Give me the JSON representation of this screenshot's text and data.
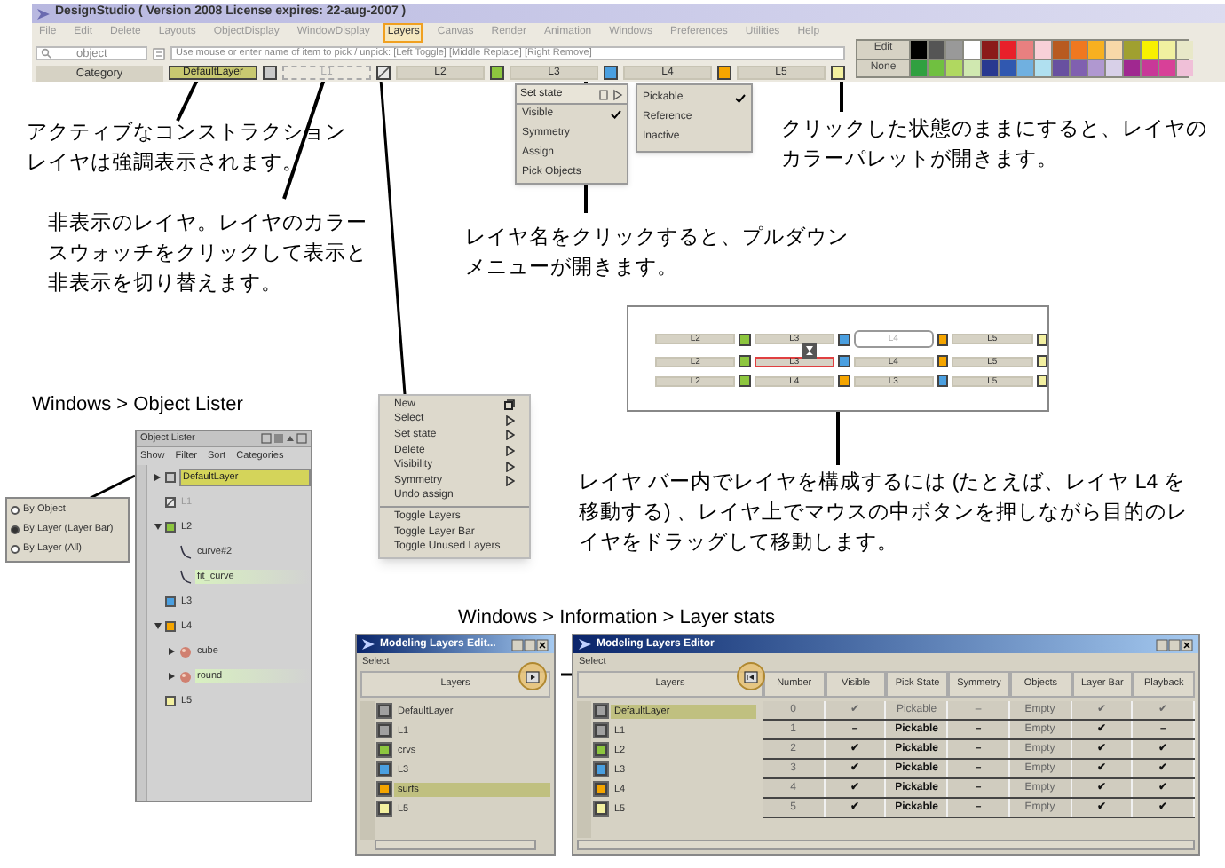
{
  "app_window": {
    "title": "DesignStudio ( Version 2008  License expires: 22-aug-2007 )",
    "menu": [
      {
        "label": "File",
        "selected": false
      },
      {
        "label": "Edit",
        "selected": false
      },
      {
        "label": "Delete",
        "selected": false
      },
      {
        "label": "Layouts",
        "selected": false
      },
      {
        "label": "ObjectDisplay",
        "selected": false
      },
      {
        "label": "WindowDisplay",
        "selected": false
      },
      {
        "label": "Layers",
        "selected": true
      },
      {
        "label": "Canvas",
        "selected": false
      },
      {
        "label": "Render",
        "selected": false
      },
      {
        "label": "Animation",
        "selected": false
      },
      {
        "label": "Windows",
        "selected": false
      },
      {
        "label": "Preferences",
        "selected": false
      },
      {
        "label": "Utilities",
        "selected": false
      },
      {
        "label": "Help",
        "selected": false
      }
    ],
    "pick_field": {
      "value": "object"
    },
    "pick_hint": {
      "placeholder": "Use mouse or enter name of item to pick / unpick: [Left Toggle] [Middle Replace] [Right Remove]"
    },
    "layer_bar": {
      "category": "Category",
      "layers": [
        {
          "name": "DefaultLayer",
          "color": "#c8c8c8",
          "active": true,
          "visible": true
        },
        {
          "name": "L1",
          "color": "#e8e8e8",
          "active": false,
          "visible": false
        },
        {
          "name": "L2",
          "color": "#8dc63f",
          "active": false,
          "visible": true
        },
        {
          "name": "L3",
          "color": "#4a9fe0",
          "active": false,
          "visible": true
        },
        {
          "name": "L4",
          "color": "#f5a500",
          "active": false,
          "visible": true
        },
        {
          "name": "L5",
          "color": "#f3f0a0",
          "active": false,
          "visible": true
        }
      ]
    }
  },
  "palette": {
    "buttons": [
      "Edit",
      "None"
    ],
    "swatches": [
      {
        "color": "#000000"
      },
      {
        "color": "#555555"
      },
      {
        "color": "#999999"
      },
      {
        "color": "#ffffff"
      },
      {
        "color": "#8b1a1a"
      },
      {
        "color": "#e8202a"
      },
      {
        "color": "#e88080"
      },
      {
        "color": "#f8d0d8"
      },
      {
        "color": "#b85a20"
      },
      {
        "color": "#f07820"
      },
      {
        "color": "#f8b020"
      },
      {
        "color": "#f8d8a8"
      },
      {
        "color": "#a0a030"
      },
      {
        "color": "#f8f000"
      },
      {
        "color": "#f0f0a0"
      },
      {
        "color": "#e8e8c8"
      },
      {
        "color": "#30a040"
      },
      {
        "color": "#70c040"
      },
      {
        "color": "#b0d860"
      },
      {
        "color": "#d0e8b0"
      },
      {
        "color": "#283890"
      },
      {
        "color": "#3058b0"
      },
      {
        "color": "#70b0e0"
      },
      {
        "color": "#b0e0f0"
      },
      {
        "color": "#6850a0"
      },
      {
        "color": "#8060b0"
      },
      {
        "color": "#b098d0"
      },
      {
        "color": "#d8d0e8"
      },
      {
        "color": "#a02890"
      },
      {
        "color": "#c83898"
      },
      {
        "color": "#d84098"
      },
      {
        "color": "#f0c0d8"
      }
    ]
  },
  "layer_menu": {
    "title": "Set state",
    "items": [
      {
        "label": "Visible",
        "checked": true
      },
      {
        "label": "Symmetry",
        "checked": false
      },
      {
        "label": "Assign",
        "checked": false
      },
      {
        "label": "Pick Objects",
        "checked": false
      }
    ],
    "submenu": [
      {
        "label": "Pickable",
        "checked": true
      },
      {
        "label": "Reference",
        "checked": false
      },
      {
        "label": "Inactive",
        "checked": false
      }
    ]
  },
  "callouts": [
    {
      "text": "アクティブなコンストラクションレイヤは強調表示されます。"
    },
    {
      "text": "非表示のレイヤ。レイヤのカラースウォッチをクリックして表示と非表示を切り替えます。"
    },
    {
      "text": "クリックした状態のままにすると、レイヤのカラーパレットが開きます。"
    },
    {
      "text": "レイヤ名をクリックすると、プルダウンメニューが開きます。"
    },
    {
      "text": "レイヤ バー内でレイヤを構成するには (たとえば、レイヤ L4 を移動する) 、レイヤ上でマウスの中ボタンを押しながら目的のレイヤをドラッグして移動します。"
    }
  ],
  "layers_menu": {
    "groups": [
      [
        {
          "label": "New",
          "kind": "window"
        },
        {
          "label": "Select",
          "kind": "submenu"
        },
        {
          "label": "Set state",
          "kind": "submenu"
        },
        {
          "label": "Delete",
          "kind": "submenu"
        },
        {
          "label": "Visibility",
          "kind": "submenu"
        },
        {
          "label": "Symmetry",
          "kind": "submenu"
        },
        {
          "label": "Undo assign",
          "kind": "plain"
        }
      ],
      [
        {
          "label": "Toggle Layers",
          "kind": "plain"
        },
        {
          "label": "Toggle Layer Bar",
          "kind": "plain"
        },
        {
          "label": "Toggle Unused Layers",
          "kind": "plain"
        }
      ]
    ]
  },
  "reorder_demo": {
    "rows": [
      [
        {
          "name": "L2",
          "color": "#8dc63f",
          "kind": "normal"
        },
        {
          "name": "L3",
          "color": "#4a9fe0",
          "kind": "normal"
        },
        {
          "name": "L4",
          "color": "#f5a500",
          "kind": "ghost"
        },
        {
          "name": "L5",
          "color": "#f3f0a0",
          "kind": "normal"
        }
      ],
      [
        {
          "name": "L2",
          "color": "#8dc63f",
          "kind": "normal"
        },
        {
          "name": "L3",
          "color": "#4a9fe0",
          "kind": "drop"
        },
        {
          "name": "L4",
          "color": "#f5a500",
          "kind": "normal"
        },
        {
          "name": "L5",
          "color": "#f3f0a0",
          "kind": "normal"
        }
      ],
      [
        {
          "name": "L2",
          "color": "#8dc63f",
          "kind": "normal"
        },
        {
          "name": "L4",
          "color": "#f5a500",
          "kind": "normal"
        },
        {
          "name": "L3",
          "color": "#4a9fe0",
          "kind": "normal"
        },
        {
          "name": "L5",
          "color": "#f3f0a0",
          "kind": "normal"
        }
      ]
    ]
  },
  "object_lister": {
    "caption": "Windows > Object Lister",
    "title": "Object Lister",
    "menu": [
      "Show",
      "Filter",
      "Sort",
      "Categories"
    ],
    "show_options": [
      {
        "label": "By Object",
        "selected": false
      },
      {
        "label": "By Layer (Layer Bar)",
        "selected": true
      },
      {
        "label": "By Layer (All)",
        "selected": false
      }
    ],
    "tree": [
      {
        "label": "DefaultLayer",
        "kind": "layer",
        "color": "#c8c8c8",
        "hidden": false,
        "expanded": false,
        "active": true,
        "selected": false
      },
      {
        "label": "L1",
        "kind": "layer",
        "color": "#e8e8e8",
        "hidden": true,
        "active": false,
        "selected": false
      },
      {
        "label": "L2",
        "kind": "layer",
        "color": "#8dc63f",
        "hidden": false,
        "expanded": true,
        "active": false,
        "selected": false,
        "children": [
          {
            "label": "curve#2",
            "kind": "curve",
            "active": false,
            "selected": false
          },
          {
            "label": "fit_curve",
            "kind": "curve",
            "active": false,
            "selected": true
          }
        ]
      },
      {
        "label": "L3",
        "kind": "layer",
        "color": "#4a9fe0",
        "hidden": false,
        "active": false,
        "selected": false
      },
      {
        "label": "L4",
        "kind": "layer",
        "color": "#f5a500",
        "hidden": false,
        "expanded": true,
        "active": false,
        "selected": false,
        "children": [
          {
            "label": "cube",
            "kind": "object",
            "expanded": false,
            "active": false,
            "selected": false
          },
          {
            "label": "round",
            "kind": "object",
            "expanded": false,
            "active": false,
            "selected": true
          }
        ]
      },
      {
        "label": "L5",
        "kind": "layer",
        "color": "#f3f0a0",
        "hidden": false,
        "active": false,
        "selected": false
      }
    ]
  },
  "layer_stats": {
    "caption": "Windows > Information > Layer stats",
    "compact_editor": {
      "title": "Modeling Layers Edit...",
      "menu": "Select",
      "column": "Layers",
      "rows": [
        {
          "name": "DefaultLayer",
          "color": "#a0a0a0",
          "selected": false
        },
        {
          "name": "L1",
          "color": "#a0a0a0",
          "selected": false
        },
        {
          "name": "crvs",
          "color": "#8dc63f",
          "selected": false
        },
        {
          "name": "L3",
          "color": "#4a9fe0",
          "selected": false
        },
        {
          "name": "surfs",
          "color": "#f5a500",
          "selected": true
        },
        {
          "name": "L5",
          "color": "#f3f0a0",
          "selected": false
        }
      ]
    },
    "full_editor": {
      "title": "Modeling Layers Editor",
      "menu": "Select",
      "layers_column": "Layers",
      "columns": [
        "Number",
        "Visible",
        "Pick State",
        "Symmetry",
        "Objects",
        "Layer Bar",
        "Playback"
      ],
      "rows": [
        {
          "name": "DefaultLayer",
          "color": "#a0a0a0",
          "selected": true,
          "dimmed": true,
          "cells": [
            "0",
            "✔",
            "Pickable",
            "–",
            "Empty",
            "✔",
            "✔"
          ]
        },
        {
          "name": "L1",
          "color": "#a0a0a0",
          "selected": false,
          "dimmed": false,
          "cells": [
            "1",
            "–",
            "Pickable",
            "–",
            "Empty",
            "✔",
            "–"
          ]
        },
        {
          "name": "L2",
          "color": "#8dc63f",
          "selected": false,
          "dimmed": false,
          "cells": [
            "2",
            "✔",
            "Pickable",
            "–",
            "Empty",
            "✔",
            "✔"
          ]
        },
        {
          "name": "L3",
          "color": "#4a9fe0",
          "selected": false,
          "dimmed": false,
          "cells": [
            "3",
            "✔",
            "Pickable",
            "–",
            "Empty",
            "✔",
            "✔"
          ]
        },
        {
          "name": "L4",
          "color": "#f5a500",
          "selected": false,
          "dimmed": false,
          "cells": [
            "4",
            "✔",
            "Pickable",
            "–",
            "Empty",
            "✔",
            "✔"
          ]
        },
        {
          "name": "L5",
          "color": "#f3f0a0",
          "selected": false,
          "dimmed": false,
          "cells": [
            "5",
            "✔",
            "Pickable",
            "–",
            "Empty",
            "✔",
            "✔"
          ]
        }
      ]
    }
  }
}
